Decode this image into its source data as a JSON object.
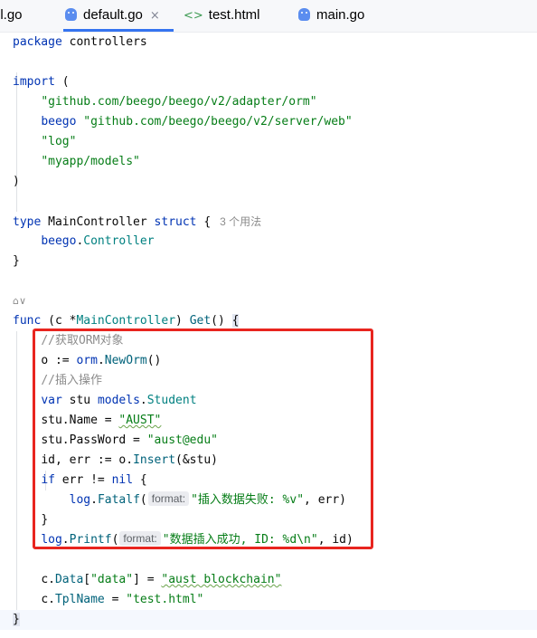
{
  "tabs": [
    {
      "label": "el.go",
      "icon": "none",
      "active": false
    },
    {
      "label": "default.go",
      "icon": "gopher-icon",
      "active": true,
      "close": "×"
    },
    {
      "label": "test.html",
      "icon": "html-icon",
      "active": false
    },
    {
      "label": "main.go",
      "icon": "gopher-icon",
      "active": false
    }
  ],
  "code": {
    "l1": {
      "kw": "package",
      "rest": " controllers"
    },
    "l3": {
      "kw": "import",
      "rest": " ("
    },
    "l4": {
      "str": "\"github.com/beego/beego/v2/adapter/orm\""
    },
    "l5": {
      "alias": "beego",
      "str": "\"github.com/beego/beego/v2/server/web\""
    },
    "l6": {
      "str": "\"log\""
    },
    "l7": {
      "str": "\"myapp/models\""
    },
    "l8": {
      "text": ")"
    },
    "l10": {
      "kw1": "type",
      "name": " MainController ",
      "kw2": "struct",
      "rest": " {",
      "hint": "3 个用法"
    },
    "l11": {
      "pkg": "beego",
      "dot": ".",
      "type": "Controller"
    },
    "l12": {
      "text": "}"
    },
    "l14": {
      "gutter": "⌂∨"
    },
    "l15": {
      "kw": "func",
      "p1": " (c *",
      "recv": "MainController",
      "p2": ") ",
      "fn": "Get",
      "p3": "() ",
      "brace": "{"
    },
    "l16": {
      "comment": "//获取ORM对象"
    },
    "l17": {
      "a": "o := ",
      "pkg": "orm",
      "dot": ".",
      "fn": "NewOrm",
      "b": "()"
    },
    "l18": {
      "comment": "//插入操作"
    },
    "l19": {
      "kw": "var",
      "a": " stu ",
      "pkg": "models",
      "dot": ".",
      "type": "Student"
    },
    "l20": {
      "a": "stu.Name = ",
      "str": "\"AUST\""
    },
    "l21": {
      "a": "stu.PassWord = ",
      "str": "\"aust@edu\""
    },
    "l22": {
      "a": "id, err := o.",
      "fn": "Insert",
      "b": "(&stu)"
    },
    "l23": {
      "kw": "if",
      "a": " err != ",
      "kw2": "nil",
      "b": " {"
    },
    "l24": {
      "pkg": "log",
      "dot": ".",
      "fn": "Fatalf",
      "open": "(",
      "hint": "format:",
      "str": "\"插入数据失败: %v\"",
      "b": ", err)"
    },
    "l25": {
      "text": "}"
    },
    "l26": {
      "pkg": "log",
      "dot": ".",
      "fn": "Printf",
      "open": "(",
      "hint": "format:",
      "str": "\"数据插入成功, ID: %d\\n\"",
      "b": ", id)"
    },
    "l28": {
      "a": "c.",
      "field": "Data",
      "b": "[",
      "str": "\"data\"",
      "c": "] = ",
      "str2": "\"aust blockchain\""
    },
    "l29": {
      "a": "c.",
      "field": "TplName",
      "b": " = ",
      "str": "\"test.html\""
    },
    "l30": {
      "text": "}"
    }
  },
  "colors": {
    "keyword": "#0033b3",
    "string": "#067d17",
    "comment": "#8c8c8c",
    "function": "#00627a",
    "highlight_border": "#e8251f",
    "tab_underline": "#3574f0"
  }
}
